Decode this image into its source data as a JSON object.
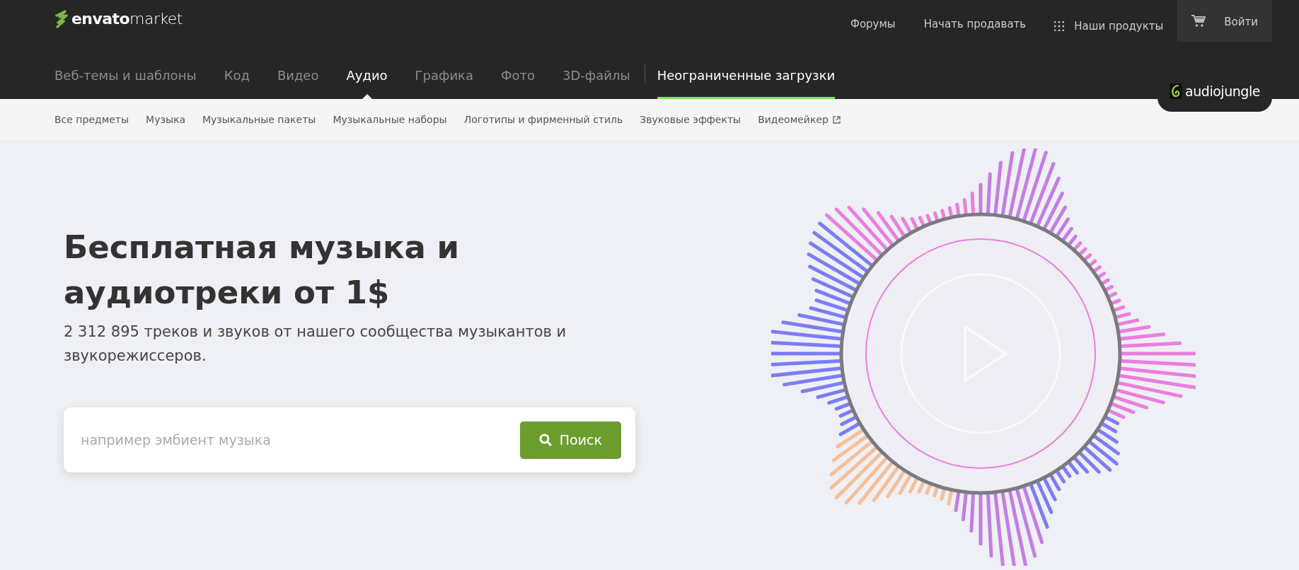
{
  "header": {
    "logo": {
      "brand": "envato",
      "product": "market"
    },
    "top_links": [
      {
        "label": "Форумы",
        "kind": "link"
      },
      {
        "label": "Начать продавать",
        "kind": "link"
      },
      {
        "label": "Наши продукты",
        "kind": "apps"
      }
    ],
    "login": "Войти",
    "categories": [
      {
        "label": "Веб-темы и шаблоны",
        "selected": false
      },
      {
        "label": "Код",
        "selected": false
      },
      {
        "label": "Видео",
        "selected": false
      },
      {
        "label": "Аудио",
        "selected": true
      },
      {
        "label": "Графика",
        "selected": false
      },
      {
        "label": "Фото",
        "selected": false
      },
      {
        "label": "3D-файлы",
        "selected": false
      }
    ],
    "unlimited": {
      "label": "Неограниченные загрузки"
    },
    "site_badge": "audiojungle"
  },
  "subnav": [
    {
      "label": "Все предметы",
      "external": false
    },
    {
      "label": "Музыка",
      "external": false
    },
    {
      "label": "Музыкальные пакеты",
      "external": false
    },
    {
      "label": "Музыкальные наборы",
      "external": false
    },
    {
      "label": "Логотипы и фирменный стиль",
      "external": false
    },
    {
      "label": "Звуковые эффекты",
      "external": false
    },
    {
      "label": "Видеомейкер",
      "external": true
    }
  ],
  "hero": {
    "title": "Бесплатная музыка и аудиотреки от 1$",
    "subtitle": "2 312 895 треков и звуков от нашего сообщества музыкантов и звукорежиссеров.",
    "search": {
      "placeholder": "например эмбиент музыка",
      "button": "Поиск"
    }
  }
}
